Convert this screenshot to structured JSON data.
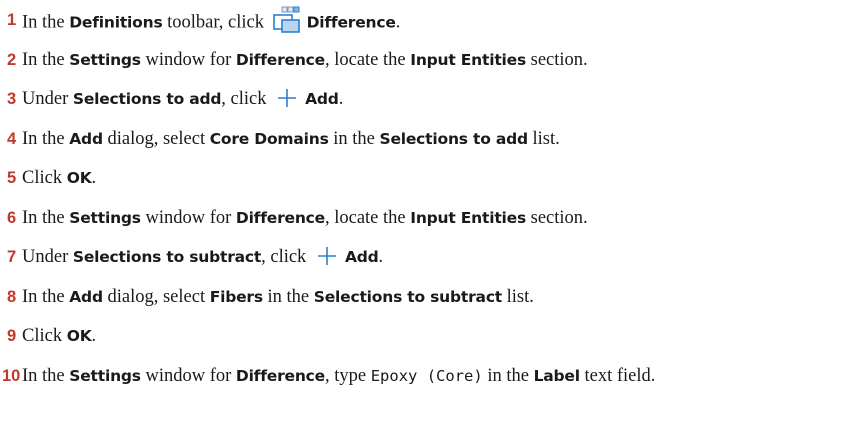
{
  "steps": [
    {
      "number": "1",
      "parts": [
        {
          "t": "text",
          "v": "In the "
        },
        {
          "t": "bold",
          "v": "Definitions"
        },
        {
          "t": "text",
          "v": " toolbar, click "
        },
        {
          "t": "icon",
          "name": "difference-icon"
        },
        {
          "t": "bold",
          "v": "Difference"
        },
        {
          "t": "text",
          "v": "."
        }
      ]
    },
    {
      "number": "2",
      "parts": [
        {
          "t": "text",
          "v": "In the "
        },
        {
          "t": "bold",
          "v": "Settings"
        },
        {
          "t": "text",
          "v": " window for "
        },
        {
          "t": "bold",
          "v": "Difference"
        },
        {
          "t": "text",
          "v": ", locate the "
        },
        {
          "t": "bold",
          "v": "Input Entities"
        },
        {
          "t": "text",
          "v": " section."
        }
      ]
    },
    {
      "number": "3",
      "parts": [
        {
          "t": "text",
          "v": "Under "
        },
        {
          "t": "bold",
          "v": "Selections to add"
        },
        {
          "t": "text",
          "v": ", click "
        },
        {
          "t": "icon",
          "name": "add-icon"
        },
        {
          "t": "bold",
          "v": "Add"
        },
        {
          "t": "text",
          "v": "."
        }
      ]
    },
    {
      "number": "4",
      "parts": [
        {
          "t": "text",
          "v": "In the "
        },
        {
          "t": "bold",
          "v": "Add"
        },
        {
          "t": "text",
          "v": " dialog, select "
        },
        {
          "t": "bold",
          "v": "Core Domains"
        },
        {
          "t": "text",
          "v": " in the "
        },
        {
          "t": "bold",
          "v": "Selections to add"
        },
        {
          "t": "text",
          "v": " list."
        }
      ]
    },
    {
      "number": "5",
      "parts": [
        {
          "t": "text",
          "v": "Click "
        },
        {
          "t": "bold",
          "v": "OK"
        },
        {
          "t": "text",
          "v": "."
        }
      ]
    },
    {
      "number": "6",
      "parts": [
        {
          "t": "text",
          "v": "In the "
        },
        {
          "t": "bold",
          "v": "Settings"
        },
        {
          "t": "text",
          "v": " window for "
        },
        {
          "t": "bold",
          "v": "Difference"
        },
        {
          "t": "text",
          "v": ", locate the "
        },
        {
          "t": "bold",
          "v": "Input Entities"
        },
        {
          "t": "text",
          "v": " section."
        }
      ]
    },
    {
      "number": "7",
      "parts": [
        {
          "t": "text",
          "v": "Under "
        },
        {
          "t": "bold",
          "v": "Selections to subtract"
        },
        {
          "t": "text",
          "v": ", click "
        },
        {
          "t": "icon",
          "name": "add-icon"
        },
        {
          "t": "bold",
          "v": "Add"
        },
        {
          "t": "text",
          "v": "."
        }
      ]
    },
    {
      "number": "8",
      "parts": [
        {
          "t": "text",
          "v": "In the "
        },
        {
          "t": "bold",
          "v": "Add"
        },
        {
          "t": "text",
          "v": " dialog, select "
        },
        {
          "t": "bold",
          "v": "Fibers"
        },
        {
          "t": "text",
          "v": " in the "
        },
        {
          "t": "bold",
          "v": "Selections to subtract"
        },
        {
          "t": "text",
          "v": " list."
        }
      ]
    },
    {
      "number": "9",
      "parts": [
        {
          "t": "text",
          "v": "Click "
        },
        {
          "t": "bold",
          "v": "OK"
        },
        {
          "t": "text",
          "v": "."
        }
      ]
    },
    {
      "number": "10",
      "parts": [
        {
          "t": "text",
          "v": "In the "
        },
        {
          "t": "bold",
          "v": "Settings"
        },
        {
          "t": "text",
          "v": " window for "
        },
        {
          "t": "bold",
          "v": "Difference"
        },
        {
          "t": "text",
          "v": ", type "
        },
        {
          "t": "mono",
          "v": "Epoxy (Core)"
        },
        {
          "t": "text",
          "v": " in the "
        },
        {
          "t": "bold",
          "v": "Label"
        },
        {
          "t": "text",
          "v": " text field."
        }
      ]
    }
  ],
  "colors": {
    "step_number": "#c0392b",
    "icon_blue": "#2f7fd3",
    "icon_light": "#b7d6f3"
  }
}
